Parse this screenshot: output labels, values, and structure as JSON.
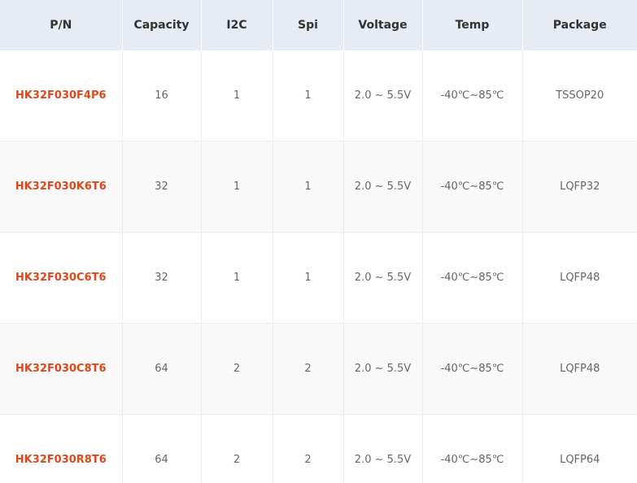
{
  "table": {
    "headers": [
      "P/N",
      "Capacity",
      "I2C",
      "Spi",
      "Voltage",
      "Temp",
      "Package"
    ],
    "rows": [
      {
        "pn": "HK32F030F4P6",
        "capacity": "16",
        "i2c": "1",
        "spi": "1",
        "voltage": "2.0 ~ 5.5V",
        "temp": "-40℃~85℃",
        "package": "TSSOP20"
      },
      {
        "pn": "HK32F030K6T6",
        "capacity": "32",
        "i2c": "1",
        "spi": "1",
        "voltage": "2.0 ~ 5.5V",
        "temp": "-40℃~85℃",
        "package": "LQFP32"
      },
      {
        "pn": "HK32F030C6T6",
        "capacity": "32",
        "i2c": "1",
        "spi": "1",
        "voltage": "2.0 ~ 5.5V",
        "temp": "-40℃~85℃",
        "package": "LQFP48"
      },
      {
        "pn": "HK32F030C8T6",
        "capacity": "64",
        "i2c": "2",
        "spi": "2",
        "voltage": "2.0 ~ 5.5V",
        "temp": "-40℃~85℃",
        "package": "LQFP48"
      },
      {
        "pn": "HK32F030R8T6",
        "capacity": "64",
        "i2c": "2",
        "spi": "2",
        "voltage": "2.0 ~ 5.5V",
        "temp": "-40℃~85℃",
        "package": "LQFP64"
      }
    ]
  },
  "colors": {
    "header_bg": "#e7ecf4",
    "pn_text": "#e0471b",
    "cell_text": "#666666",
    "alt_row_bg": "#f9f9f9"
  }
}
